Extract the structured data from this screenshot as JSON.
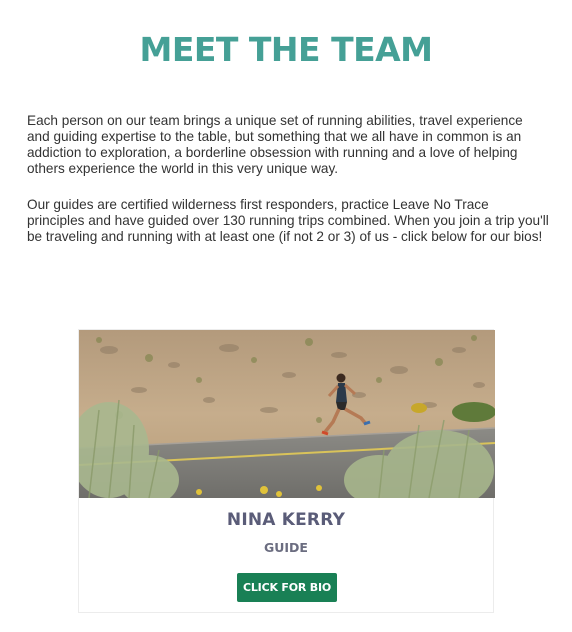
{
  "header": {
    "title": "MEET THE TEAM"
  },
  "intro": {
    "paragraph_1": "Each person on our team brings a unique set of running abilities, travel experience and guiding expertise to the table, but something that we all have in common is an addiction to exploration, a borderline obsession with running and a love of helping others experience the world in this very unique way.",
    "paragraph_2": "Our guides are certified wilderness first responders, practice Leave No Trace principles and have guided over 130 running trips combined. When you join a trip you'll be traveling and running with at least one (if not 2 or 3) of us - click below for our bios!"
  },
  "team": {
    "members": [
      {
        "name": "NINA KERRY",
        "role": "GUIDE",
        "button_label": "CLICK FOR BIO"
      }
    ]
  },
  "colors": {
    "title": "#45a096",
    "body_text": "#333333",
    "name_text": "#5a5c78",
    "button_bg": "#198055",
    "button_text": "#ffffff"
  }
}
